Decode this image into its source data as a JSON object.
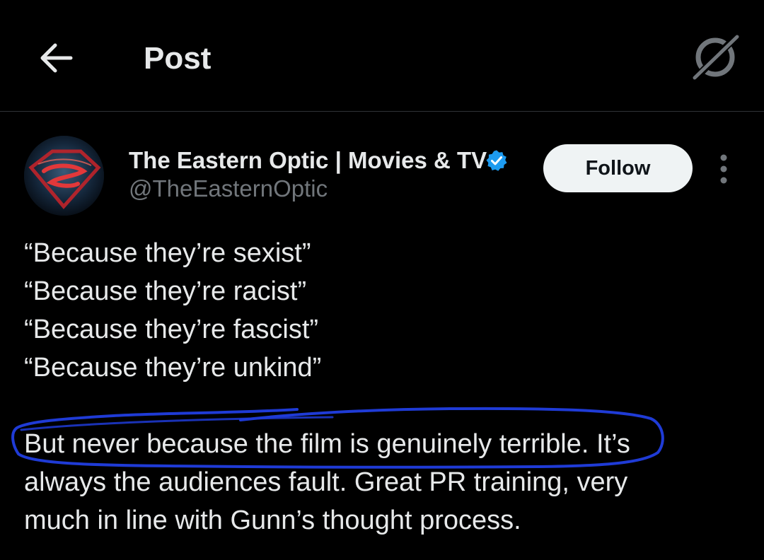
{
  "header": {
    "title": "Post",
    "back_icon": "arrow-left-icon",
    "grok_icon": "grok-icon"
  },
  "post": {
    "author": {
      "display_name": "The Eastern Optic | Movies & TV",
      "handle": "@TheEasternOptic",
      "verified_icon": "verified-badge-icon"
    },
    "follow_label": "Follow",
    "more_icon": "more-vertical-icon",
    "text_lines": [
      "“Because they’re sexist”",
      "“Because they’re racist”",
      "“Because they’re fascist”",
      "“Because they’re unkind”"
    ],
    "paragraph_lines": [
      "But never because the film is genuinely terrible. It’s",
      "always the audiences fault. Great PR training, very",
      "much in line with Gunn’s thought process."
    ]
  },
  "colors": {
    "background": "#000000",
    "text_primary": "#e7e9ea",
    "text_secondary": "#71767b",
    "verified_blue": "#1d9bf0",
    "annotation_blue": "#1f3bd6"
  }
}
